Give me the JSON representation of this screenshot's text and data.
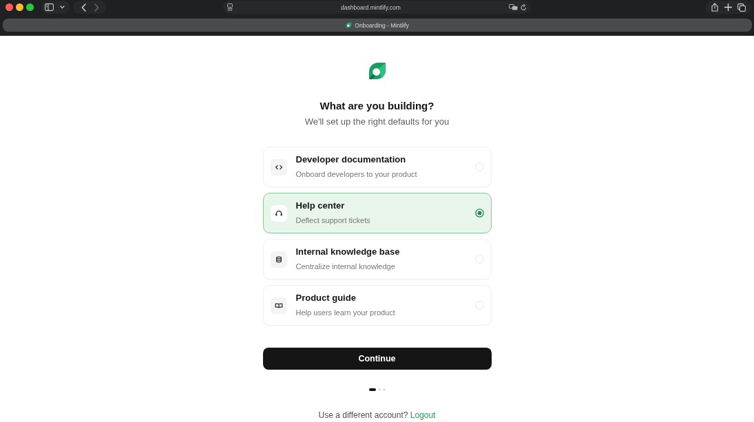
{
  "browser": {
    "url": "dashboard.mintlify.com",
    "tab": {
      "title": "Onboarding - Mintlify"
    }
  },
  "onboarding": {
    "title": "What are you building?",
    "subtitle": "We'll set up the right defaults for you",
    "options": [
      {
        "title": "Developer documentation",
        "description": "Onboard developers to your product",
        "selected": false
      },
      {
        "title": "Help center",
        "description": "Deflect support tickets",
        "selected": true
      },
      {
        "title": "Internal knowledge base",
        "description": "Centralize internal knowledge",
        "selected": false
      },
      {
        "title": "Product guide",
        "description": "Help users learn your product",
        "selected": false
      }
    ],
    "continue_button": "Continue",
    "steps": [
      {
        "selected": true
      },
      {
        "selected": false
      },
      {
        "selected": false
      }
    ],
    "footer": {
      "text": "Use a different account?",
      "link": "Logout"
    }
  }
}
